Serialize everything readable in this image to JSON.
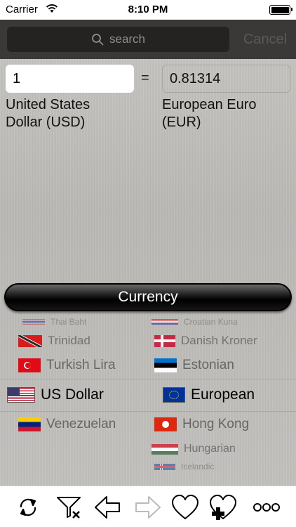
{
  "status_bar": {
    "carrier": "Carrier",
    "time": "8:10 PM"
  },
  "search": {
    "placeholder": "search",
    "cancel_label": "Cancel"
  },
  "converter": {
    "amount": "1",
    "equals": "=",
    "result": "0.81314",
    "from_currency_line1": "United States",
    "from_currency_line2": "Dollar (USD)",
    "to_currency_line1": "European Euro",
    "to_currency_line2": "(EUR)"
  },
  "category_button": "Currency",
  "picker": {
    "left": [
      {
        "label": "Thai Baht",
        "flag": "thailand-flag"
      },
      {
        "label": "Trinidad",
        "flag": "trinidad-flag"
      },
      {
        "label": "Turkish Lira",
        "flag": "turkey-flag"
      },
      {
        "label": "US Dollar",
        "flag": "us-flag",
        "selected": true
      },
      {
        "label": "Venezuelan",
        "flag": "venezuela-flag"
      }
    ],
    "right": [
      {
        "label": "Croatian Kuna",
        "flag": "croatia-flag"
      },
      {
        "label": "Danish Kroner",
        "flag": "denmark-flag"
      },
      {
        "label": "Estonian",
        "flag": "estonia-flag"
      },
      {
        "label": "European",
        "flag": "eu-flag",
        "selected": true
      },
      {
        "label": "Hong Kong",
        "flag": "hong-kong-flag"
      },
      {
        "label": "Hungarian",
        "flag": "hungary-flag"
      },
      {
        "label": "Icelandic",
        "flag": "iceland-flag"
      }
    ]
  },
  "toolbar": {
    "items": [
      "swap-icon",
      "clear-filter-icon",
      "back-arrow-icon",
      "forward-arrow-icon",
      "favorite-heart-icon",
      "add-favorite-icon",
      "more-icon"
    ]
  },
  "colors": {
    "search_bar_bg": "#3a3937",
    "currency_button_bg": "#000000",
    "toolbar_bg": "#ffffff"
  }
}
